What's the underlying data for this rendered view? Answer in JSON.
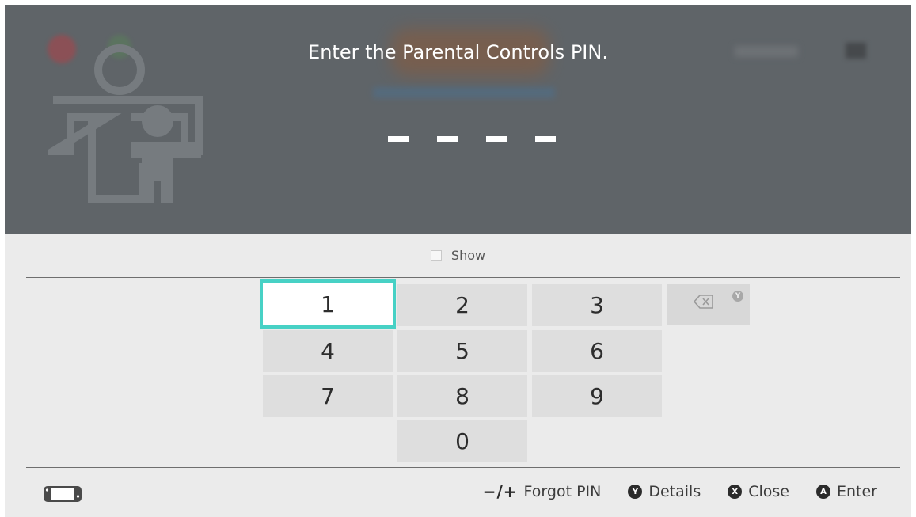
{
  "dialog": {
    "prompt": "Enter the Parental Controls PIN.",
    "pin_placeholder": [
      "–",
      "–",
      "–",
      "–"
    ],
    "show_label": "Show"
  },
  "keypad": {
    "keys": [
      "1",
      "2",
      "3",
      "4",
      "5",
      "6",
      "7",
      "8",
      "9",
      "0"
    ],
    "selected_key": "1",
    "backspace_icon": "backspace-icon",
    "backspace_button_hint": "Y"
  },
  "footer": {
    "forgot_prefix": "−/+",
    "forgot_label": "Forgot PIN",
    "details_button": "Y",
    "details_label": "Details",
    "close_button": "X",
    "close_label": "Close",
    "enter_button": "A",
    "enter_label": "Enter"
  },
  "colors": {
    "overlay": "#5f6468",
    "background": "#ebebeb",
    "key": "#dedede",
    "selection_border": "#47d1c5"
  }
}
